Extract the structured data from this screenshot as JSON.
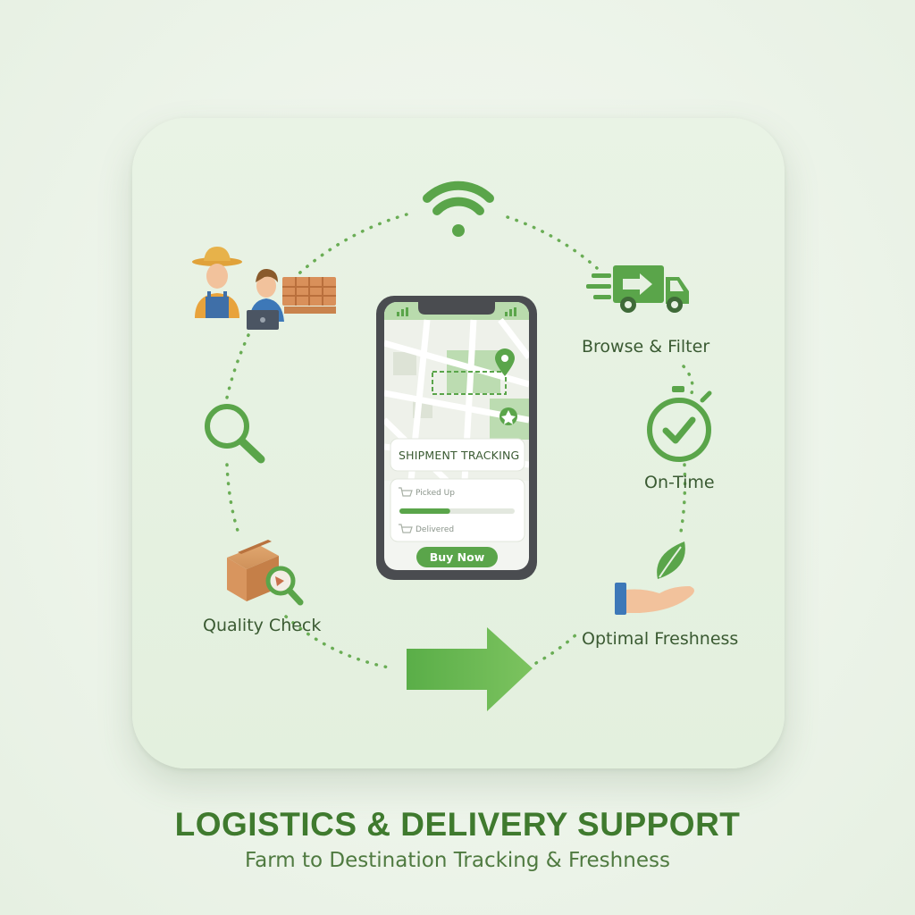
{
  "title": "LOGISTICS & DELIVERY SUPPORT",
  "subtitle": "Farm to Destination Tracking & Freshness",
  "labels": {
    "browse": "Browse & Filter",
    "ontime": "On-Time",
    "quality": "Quality Check",
    "freshness": "Optimal Freshness"
  },
  "phone": {
    "tracking_title": "SHIPMENT TRACKING",
    "status_1": "Picked Up",
    "status_2": "Delivered",
    "button": "Buy Now",
    "progress": 0.44
  },
  "icons": [
    "wifi-icon",
    "delivery-truck-icon",
    "stopwatch-check-icon",
    "leaf-in-hand-icon",
    "forward-arrow-icon",
    "box-inspection-icon",
    "magnifier-icon",
    "farmer-and-buyer-icon",
    "map-pin-icon",
    "store-pin-icon",
    "cart-icon"
  ],
  "colors": {
    "accent": "#5aa54a",
    "text": "#3a5a32",
    "title": "#3f7a2e",
    "card": "#e6f1e1"
  }
}
